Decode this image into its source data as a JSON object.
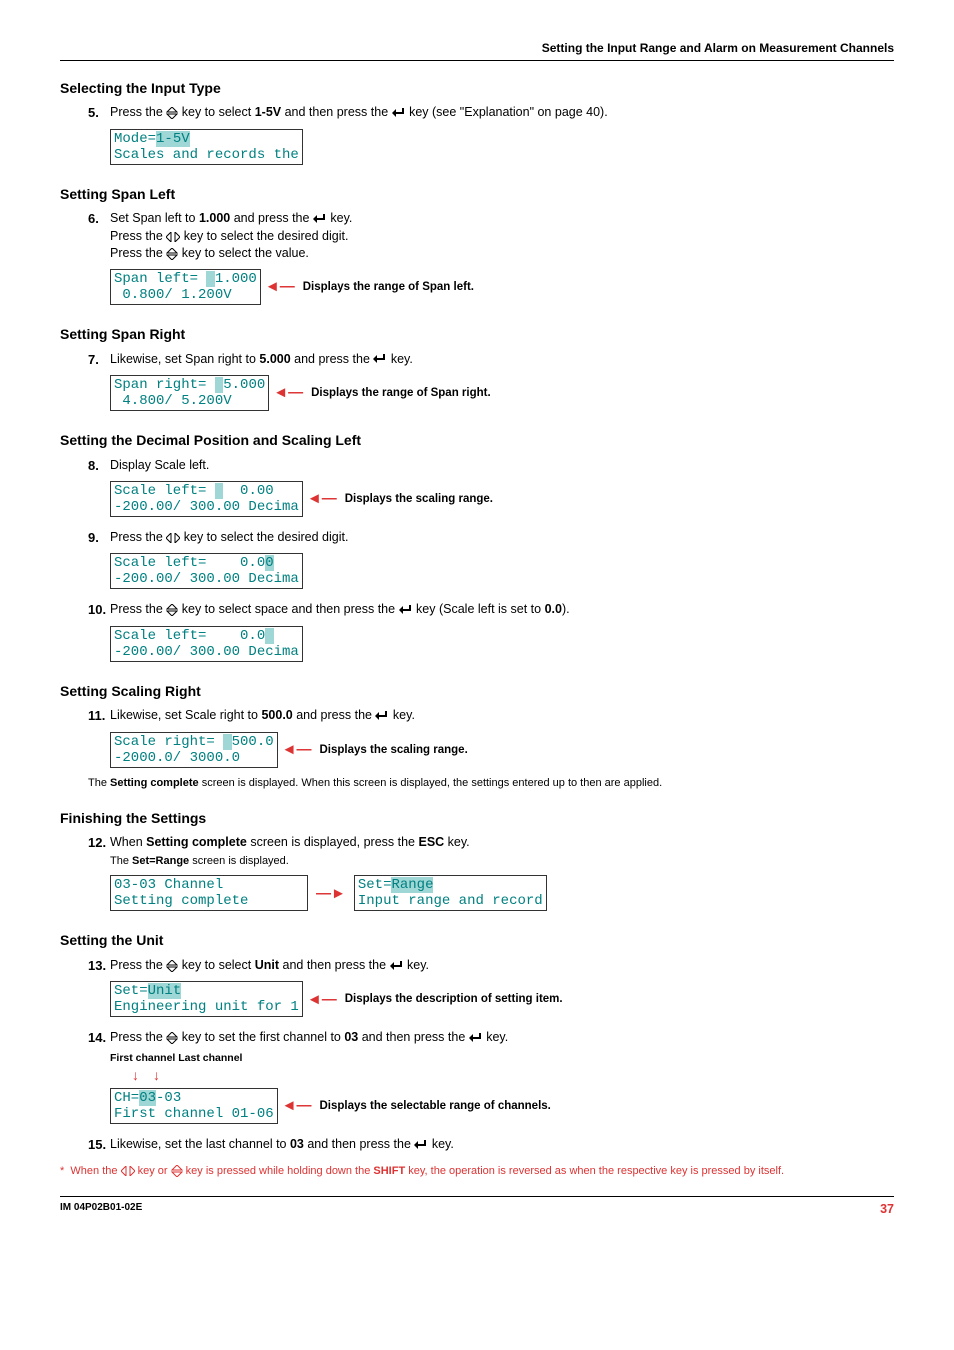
{
  "header": "Setting the Input Range and Alarm on Measurement Channels",
  "s1": {
    "h": "Selecting the Input Type",
    "n": "5.",
    "t1": "Press the ",
    "t2": " key to select ",
    "b1": "1-5V",
    "t3": " and then press the ",
    "t4": " key (see \"Explanation\" on page 40).",
    "lcd": "Mode=",
    "hl": "1-5V",
    "lcd2": "\nScales and records the"
  },
  "s2": {
    "h": "Setting Span Left",
    "n": "6.",
    "t1": "Set Span left to ",
    "b1": "1.000",
    "t2": " and press the ",
    "t3": " key.",
    "l2a": "Press the ",
    "l2b": " key to select the desired digit.",
    "l3a": "Press the ",
    "l3b": " key to select the value.",
    "lcd1": "Span left= ",
    "hl": " ",
    "lcd1b": "1.000\n 0.800/ 1.200V",
    "call": "Displays the range of Span left."
  },
  "s3": {
    "h": "Setting Span Right",
    "n": "7.",
    "t1": "Likewise, set Span right to ",
    "b1": "5.000",
    "t2": " and press the ",
    "t3": " key.",
    "lcd1": "Span right= ",
    "hl": " ",
    "lcd1b": "5.000\n 4.800/ 5.200V",
    "call": "Displays the range of Span right."
  },
  "s4": {
    "h": "Setting the Decimal Position and Scaling Left",
    "n8": "8.",
    "t8": "Display Scale left.",
    "lcd8a": "Scale left= ",
    "hl8": " ",
    "lcd8b": "  0.00\n-200.00/ 300.00 Decima",
    "call8": "Displays the scaling range.",
    "n9": "9.",
    "t9a": "Press the ",
    "t9b": " key to select the desired digit.",
    "lcd9": "Scale left=    0.0",
    "hl9": "0",
    "lcd9b": "\n-200.00/ 300.00 Decima",
    "n10": "10.",
    "t10a": "Press the ",
    "t10b": " key to select space and then press the ",
    "t10c": " key (Scale left is set to ",
    "b10": "0.0",
    "t10d": ").",
    "lcd10": "Scale left=    0.0",
    "hl10": " ",
    "lcd10b": "\n-200.00/ 300.00 Decima"
  },
  "s5": {
    "h": "Setting Scaling Right",
    "n": "11.",
    "t1": "Likewise, set Scale right to ",
    "b1": "500.0",
    "t2": " and press the ",
    "t3": " key.",
    "lcd1": "Scale right= ",
    "hl": " ",
    "lcd1b": "500.0\n-2000.0/ 3000.0",
    "call": "Displays the scaling range.",
    "note1": "The ",
    "nb": "Setting complete",
    "note2": " screen is displayed. When this screen is displayed, the settings entered up to then are applied."
  },
  "s6": {
    "h": "Finishing the Settings",
    "n": "12.",
    "t1": "When ",
    "b1": "Setting complete",
    "t2": " screen is displayed, press the ",
    "b2": "ESC",
    "t3": " key.",
    "sub": "The ",
    "subb": "Set=Range",
    "sub2": " screen is displayed.",
    "lcdA": "03-03 Channel\nSetting complete",
    "lcdB1": "Set=",
    "hlB": "Range",
    "lcdB2": "\nInput range and record"
  },
  "s7": {
    "h": "Setting the Unit",
    "n13": "13.",
    "t13a": "Press the ",
    "t13b": " key to select ",
    "b13": "Unit",
    "t13c": " and then press the ",
    "t13d": " key.",
    "lcd13a": "Set=",
    "hl13": "Unit",
    "lcd13b": "\nEngineering unit for 1",
    "call13": "Displays the description of setting item.",
    "n14": "14.",
    "t14a": "Press the ",
    "t14b": " key to set the first channel to ",
    "b14": "03",
    "t14c": " and then press the ",
    "t14d": " key.",
    "lab14": "First channel Last channel",
    "lcd14a": "CH=",
    "hl14": "03",
    "lcd14b": "-03\nFirst channel 01-06",
    "call14": "Displays the selectable range of channels.",
    "n15": "15.",
    "t15a": "Likewise, set the last channel to ",
    "b15": "03",
    "t15b": " and then press the ",
    "t15c": " key."
  },
  "star": {
    "a": "When the ",
    "b": " key or ",
    "c": " key is pressed while holding down the ",
    "d": "SHIFT",
    "e": " key, the operation is reversed as when the respective key is pressed by itself."
  },
  "foot": {
    "id": "IM 04P02B01-02E",
    "pg": "37"
  }
}
